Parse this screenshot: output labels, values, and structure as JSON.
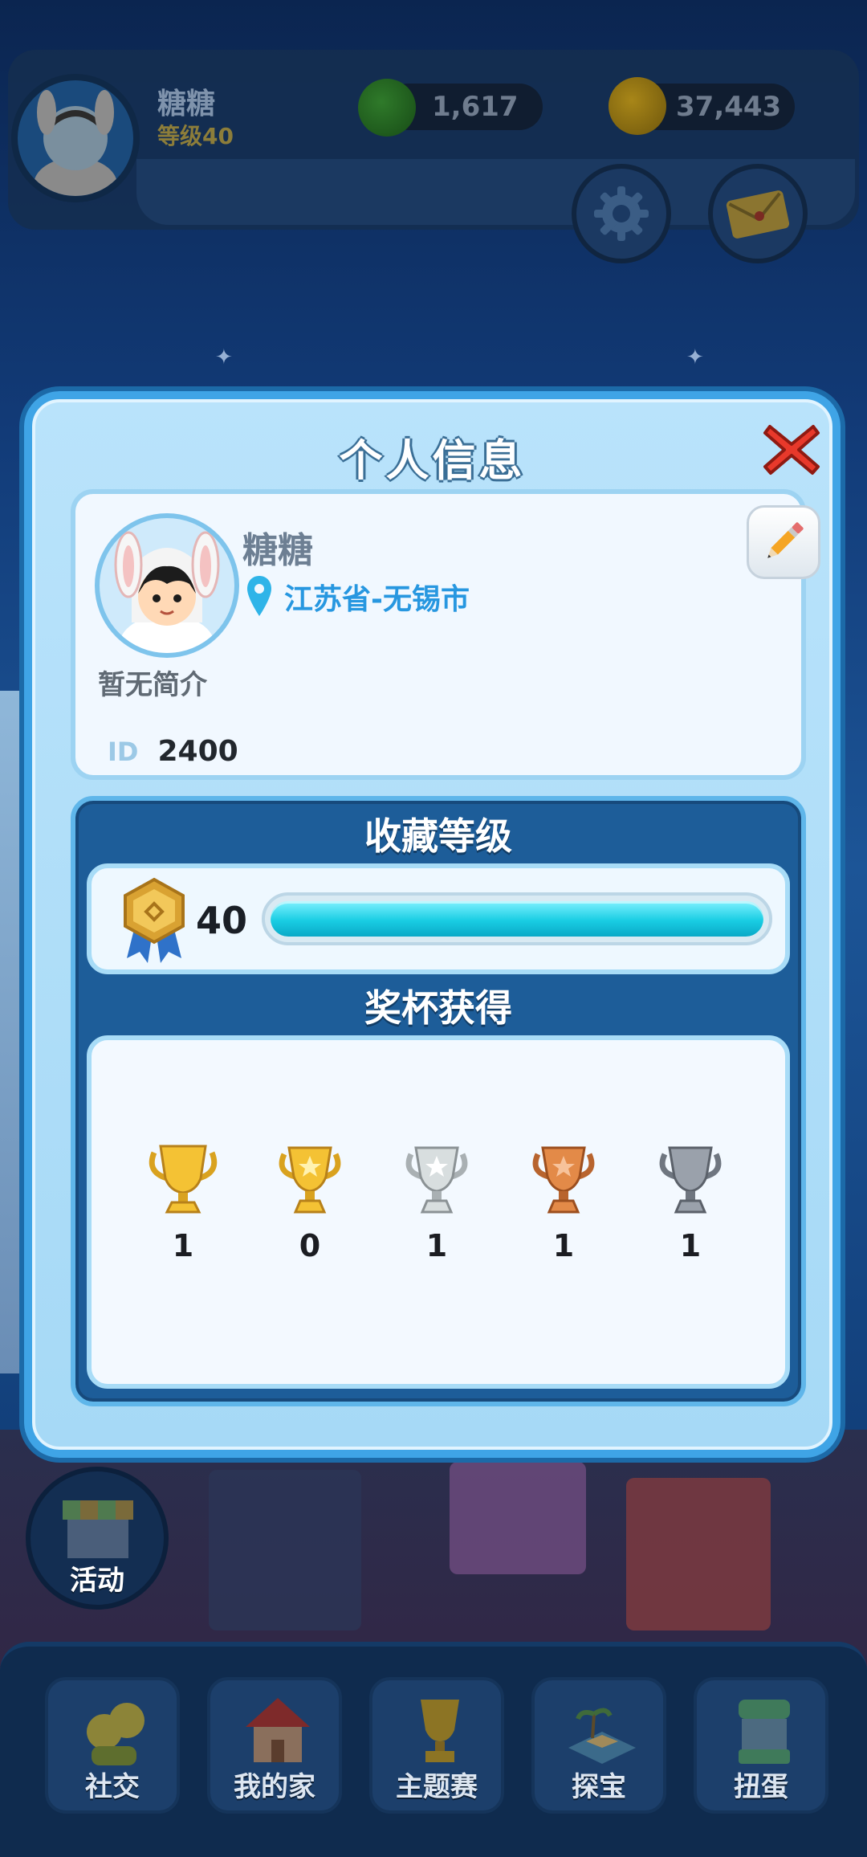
{
  "hud": {
    "player_name": "糖糖",
    "player_level": "等级40",
    "gems": "1,617",
    "coins": "37,443"
  },
  "dialog": {
    "title": "个人信息",
    "profile": {
      "name": "糖糖",
      "location": "江苏省-无锡市",
      "bio": "暂无简介",
      "id_label": "ID",
      "id_value": "2400"
    },
    "collection": {
      "title": "收藏等级",
      "level": "40",
      "progress": 1.0
    },
    "trophies": {
      "title": "奖杯获得",
      "items": [
        {
          "kind": "gold-big",
          "count": "1"
        },
        {
          "kind": "gold",
          "count": "0"
        },
        {
          "kind": "silver",
          "count": "1"
        },
        {
          "kind": "bronze",
          "count": "1"
        },
        {
          "kind": "iron",
          "count": "1"
        }
      ]
    }
  },
  "activity_label": "活动",
  "nav": [
    {
      "label": "社交"
    },
    {
      "label": "我的家"
    },
    {
      "label": "主题赛"
    },
    {
      "label": "探宝"
    },
    {
      "label": "扭蛋"
    }
  ],
  "colors": {
    "dialog_border": "#3fa4e6",
    "location": "#2797e0",
    "progress": "#19cde3",
    "close_red": "#e8392b"
  }
}
